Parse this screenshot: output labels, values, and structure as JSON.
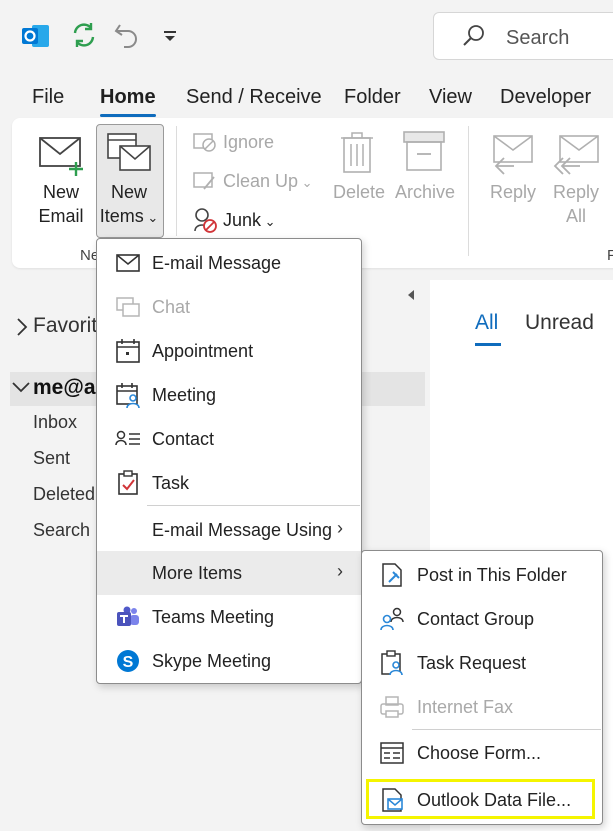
{
  "titlebar": {
    "search_label": "Search"
  },
  "tabs": [
    "File",
    "Home",
    "Send / Receive",
    "Folder",
    "View",
    "Developer"
  ],
  "ribbon": {
    "new_email": [
      "New",
      "Email"
    ],
    "new_items": [
      "New",
      "Items"
    ],
    "group_label_partial": "Ne",
    "ignore": "Ignore",
    "clean_up": "Clean Up",
    "junk": "Junk",
    "delete": "Delete",
    "archive": "Archive",
    "reply": "Reply",
    "reply_all": [
      "Reply",
      "All"
    ],
    "trailing_partial": "F"
  },
  "left_pane": {
    "favorites": "Favorit",
    "account": "me@a",
    "folders": [
      "Inbox",
      "Sent",
      "Deleted",
      "Search F"
    ]
  },
  "right_pane": {
    "filter_all": "All",
    "filter_unread": "Unread"
  },
  "new_items_menu": {
    "items": [
      {
        "label": "E-mail Message",
        "enabled": true,
        "icon": "envelope-icon"
      },
      {
        "label": "Chat",
        "enabled": false,
        "icon": "chat-icon"
      },
      {
        "label": "Appointment",
        "enabled": true,
        "icon": "calendar-icon"
      },
      {
        "label": "Meeting",
        "enabled": true,
        "icon": "meeting-icon"
      },
      {
        "label": "Contact",
        "enabled": true,
        "icon": "contact-icon"
      },
      {
        "label": "Task",
        "enabled": true,
        "icon": "task-icon"
      },
      {
        "label": "E-mail Message Using",
        "enabled": true,
        "icon": ""
      },
      {
        "label": "More Items",
        "enabled": true,
        "icon": ""
      },
      {
        "label": "Teams Meeting",
        "enabled": true,
        "icon": "teams-icon"
      },
      {
        "label": "Skype Meeting",
        "enabled": true,
        "icon": "skype-icon"
      }
    ]
  },
  "more_items_menu": {
    "items": [
      {
        "label": "Post in This Folder",
        "enabled": true,
        "icon": "post-icon"
      },
      {
        "label": "Contact Group",
        "enabled": true,
        "icon": "contact-group-icon"
      },
      {
        "label": "Task Request",
        "enabled": true,
        "icon": "task-request-icon"
      },
      {
        "label": "Internet Fax",
        "enabled": false,
        "icon": "fax-icon"
      },
      {
        "label": "Choose Form...",
        "enabled": true,
        "icon": "form-icon"
      },
      {
        "label": "Outlook Data File...",
        "enabled": true,
        "icon": "data-file-icon"
      }
    ]
  },
  "colors": {
    "accent": "#0f6cbd",
    "highlight": "#f5f500"
  }
}
